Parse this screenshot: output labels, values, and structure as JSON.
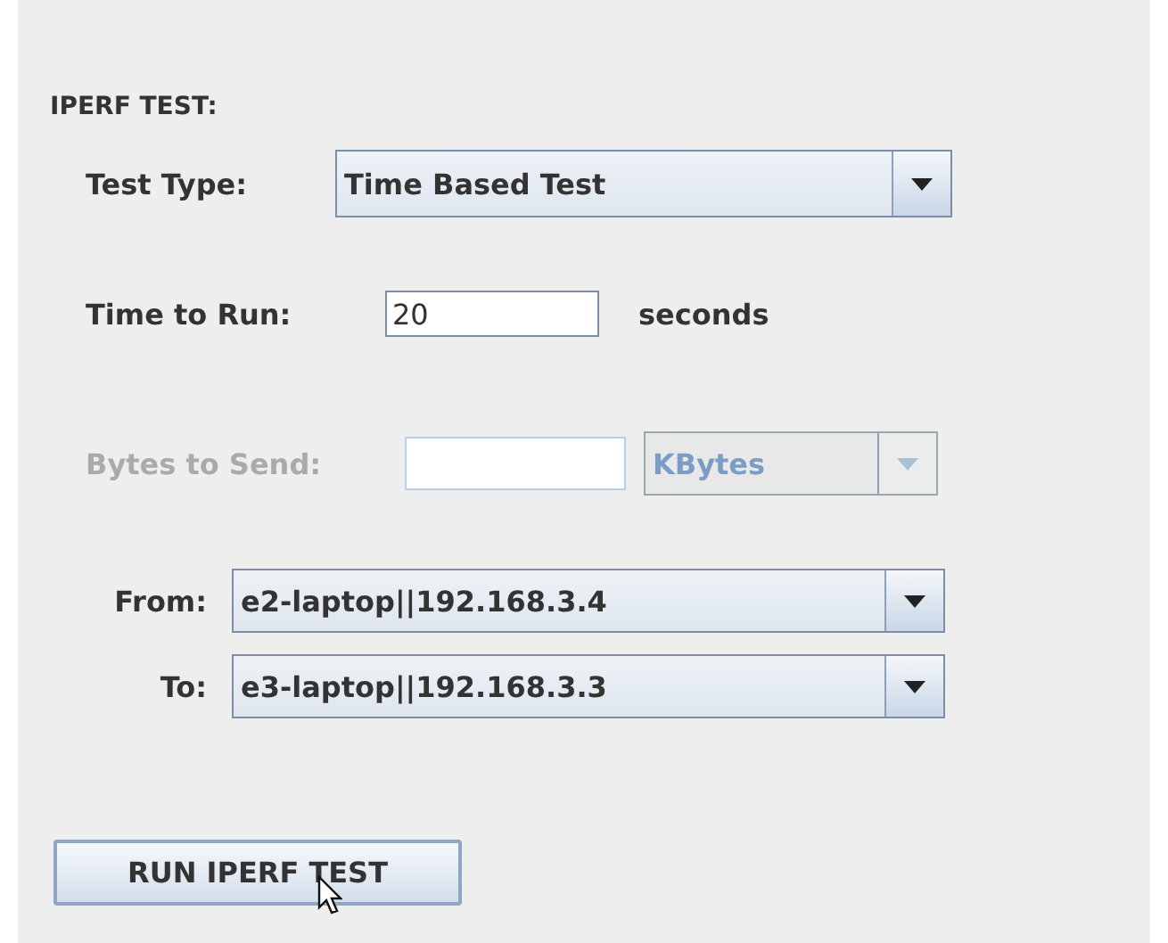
{
  "section_title": "IPERF TEST:",
  "test_type": {
    "label": "Test Type:",
    "value": "Time Based Test",
    "disabled": false
  },
  "time_to_run": {
    "label": "Time to Run:",
    "value": "20",
    "unit": "seconds",
    "disabled": false
  },
  "bytes_to_send": {
    "label": "Bytes to Send:",
    "value_unit": "KBytes",
    "disabled": true
  },
  "endpoints": [
    {
      "label": "From:",
      "value": "e2-laptop||192.168.3.4",
      "disabled": false
    },
    {
      "label": "To:",
      "value": "e3-laptop||192.168.3.3",
      "disabled": false
    }
  ],
  "run_button": {
    "label": "RUN IPERF TEST"
  }
}
